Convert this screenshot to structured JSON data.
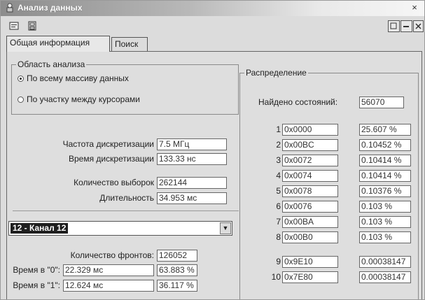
{
  "window": {
    "title": "Анализ данных",
    "close_glyph": "×"
  },
  "toolbar": {
    "icons": [
      "open-icon",
      "save-icon"
    ],
    "window_buttons": [
      "restore",
      "minimize",
      "close"
    ]
  },
  "tabs": [
    {
      "label": "Общая информация",
      "active": true
    },
    {
      "label": "Поиск",
      "active": false
    }
  ],
  "analysis_area": {
    "title": "Область анализа",
    "options": [
      {
        "label": "По всему массиву данных",
        "selected": true
      },
      {
        "label": "По участку между курсорами",
        "selected": false
      }
    ]
  },
  "params": [
    {
      "label": "Частота дискретизации",
      "value": "7.5 МГц"
    },
    {
      "label": "Время дискретизации",
      "value": "133.33 нс"
    },
    {
      "label": "Количество выборок",
      "value": "262144"
    },
    {
      "label": "Длительность",
      "value": "34.953 мс"
    }
  ],
  "channel_select": {
    "value": "12 - Канал 12"
  },
  "fronts": {
    "label": "Количество фронтов:",
    "value": "126052"
  },
  "time_rows": [
    {
      "label": "Время в \"0\":",
      "time": "22.329 мс",
      "percent": "63.883 %"
    },
    {
      "label": "Время в \"1\":",
      "time": "12.624 мс",
      "percent": "36.117 %"
    }
  ],
  "distribution": {
    "title": "Распределение",
    "found_label": "Найдено состояний:",
    "found_value": "56070",
    "rows": [
      {
        "n": "1",
        "code": "0x0000",
        "percent": "25.607 %"
      },
      {
        "n": "2",
        "code": "0x00BC",
        "percent": "0.10452 %"
      },
      {
        "n": "3",
        "code": "0x0072",
        "percent": "0.10414 %"
      },
      {
        "n": "4",
        "code": "0x0074",
        "percent": "0.10414 %"
      },
      {
        "n": "5",
        "code": "0x0078",
        "percent": "0.10376 %"
      },
      {
        "n": "6",
        "code": "0x0076",
        "percent": "0.103 %"
      },
      {
        "n": "7",
        "code": "0x00BA",
        "percent": "0.103 %"
      },
      {
        "n": "8",
        "code": "0x00B0",
        "percent": "0.103 %"
      },
      {
        "n": "9",
        "code": "0x9E10",
        "percent": "0.00038147"
      },
      {
        "n": "10",
        "code": "0x7E80",
        "percent": "0.00038147"
      }
    ]
  }
}
